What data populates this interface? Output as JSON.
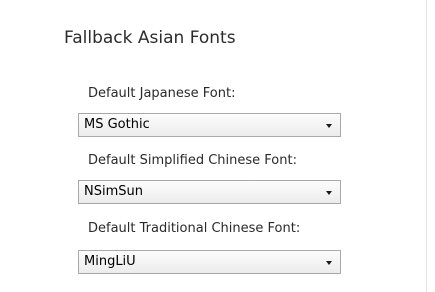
{
  "section": {
    "title": "Fallback Asian Fonts"
  },
  "fields": [
    {
      "label": "Default Japanese Font:",
      "selected_value": "MS Gothic",
      "icon": "chevron-down-icon"
    },
    {
      "label": "Default Simplified Chinese Font:",
      "selected_value": "NSimSun",
      "icon": "chevron-down-icon"
    },
    {
      "label": "Default Traditional Chinese Font:",
      "selected_value": "MingLiU",
      "icon": "chevron-down-icon"
    }
  ]
}
